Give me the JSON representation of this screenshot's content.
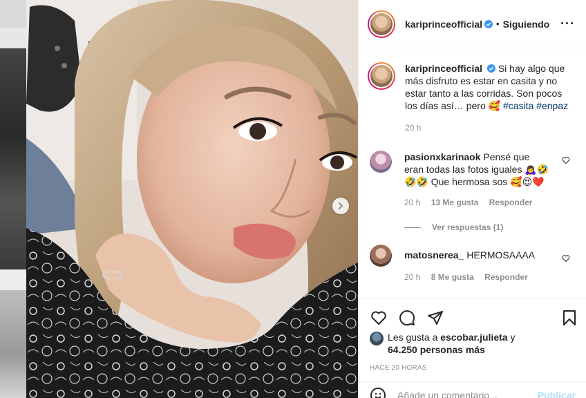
{
  "header": {
    "username": "kariprinceofficial",
    "follow_status": "Siguiendo",
    "more_icon": "more-horizontal-icon"
  },
  "caption": {
    "username": "kariprinceofficial",
    "text": "Si hay algo que más disfruto es estar en casita y no estar tanto a las corridas. Son pocos los días así… pero 🥰",
    "hashtags": "#casita #enpaz",
    "time": "20 h"
  },
  "comments": [
    {
      "username": "pasionxkarinaok",
      "text": "Pensé que eran todas las fotos iguales 🙇‍♀️🤣🤣🤣 Que hermosa sos 🥰😍❤️",
      "time": "20 h",
      "likes": "13 Me gusta",
      "reply": "Responder",
      "view_replies": "Ver respuestas (1)"
    },
    {
      "username": "matosnerea_",
      "text": "HERMOSAAAA",
      "time": "20 h",
      "likes": "8 Me gusta",
      "reply": "Responder"
    }
  ],
  "likes_summary": {
    "prefix": "Les gusta a ",
    "user": "escobar.julieta",
    "middle": " y ",
    "count": "64.250 personas más"
  },
  "posted": "HACE 20 HORAS",
  "comment_box": {
    "placeholder": "Añade un comentario...",
    "publish": "Publicar"
  },
  "colors": {
    "link": "#00376b",
    "muted": "#8e8e8e",
    "verified": "#3897f0",
    "publish_disabled": "#b2dffc"
  }
}
